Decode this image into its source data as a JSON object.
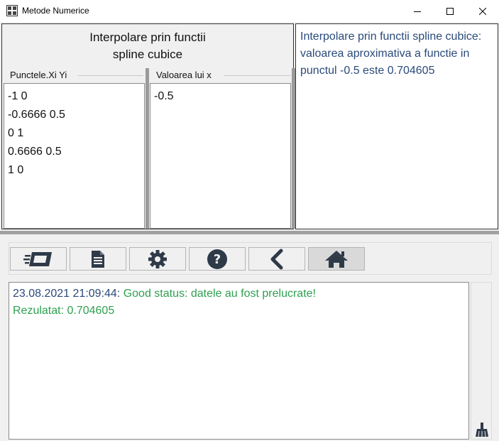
{
  "window": {
    "title": "Metode Numerice"
  },
  "left_panel": {
    "heading_line1": "Interpolare prin functii",
    "heading_line2": "spline cubice",
    "col1_label": "Punctele.Xi Yi",
    "col2_label": "Valoarea lui x",
    "points": [
      "-1 0",
      "-0.6666 0.5",
      "0 1",
      "0.6666 0.5",
      "1 0"
    ],
    "x_value": "-0.5"
  },
  "result_text": "Interpolare prin functii spline cubice: valoarea aproximativa a functie in punctul -0.5 este 0.704605",
  "toolbar": {
    "buttons": [
      "list-icon",
      "document-icon",
      "gear-icon",
      "help-icon",
      "back-icon",
      "home-icon"
    ]
  },
  "log": {
    "timestamp": "23.08.2021 21:09:44:",
    "status": "Good status: datele au fost prelucrate!",
    "result": "Rezulatat: 0.704605"
  },
  "colors": {
    "status_green": "#2ea050",
    "text_blue": "#2a4a7a",
    "icon_dark": "#2f3a48"
  }
}
